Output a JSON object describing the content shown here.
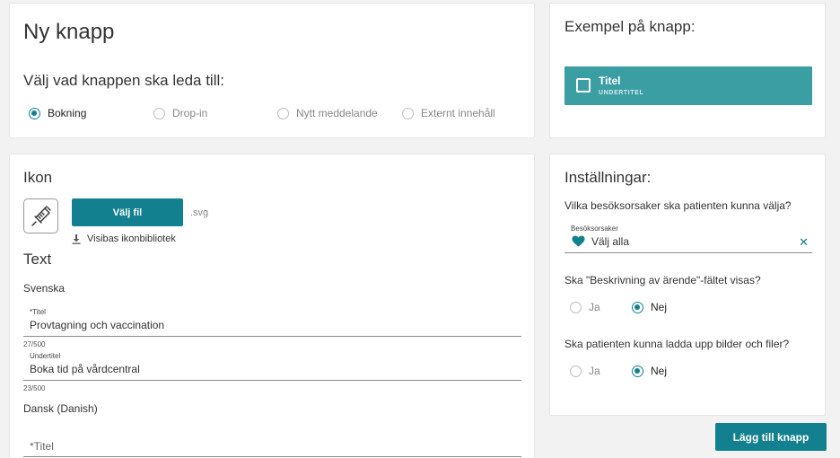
{
  "type_card": {
    "title": "Ny knapp",
    "question": "Välj vad knappen ska leda till:",
    "options": [
      {
        "label": "Bokning",
        "selected": true
      },
      {
        "label": "Drop-in",
        "selected": false
      },
      {
        "label": "Nytt meddelande",
        "selected": false
      },
      {
        "label": "Externt innehåll",
        "selected": false
      }
    ]
  },
  "preview_card": {
    "title": "Exempel på knapp:",
    "button_title": "Titel",
    "button_subtitle": "UNDERTITEL",
    "button_color": "#3a9ea3"
  },
  "icon_card": {
    "icon_heading": "Ikon",
    "icon_name": "syringe-icon",
    "choose_file_label": "Välj fil",
    "file_hint": ".svg",
    "library_link": "Visibas ikonbibliotek",
    "text_heading": "Text",
    "swedish_label": "Svenska",
    "swedish_fields": [
      {
        "label": "*Titel",
        "value": "Provtagning och vaccination",
        "counter": "27/500"
      },
      {
        "label": "Undertitel",
        "value": "Boka tid på vårdcentral",
        "counter": "23/500"
      }
    ],
    "danish_label": "Dansk (Danish)",
    "danish_fields": [
      {
        "placeholder": "*Titel"
      }
    ]
  },
  "settings_card": {
    "title": "Inställningar:",
    "cause_question": "Vilka besöksorsaker ska patienten kunna välja?",
    "cause_field_label": "Besöksorsaker",
    "cause_value": "Välj alla",
    "description_question": "Ska \"Beskrivning av ärende\"-fältet visas?",
    "description_options": [
      {
        "label": "Ja",
        "selected": false
      },
      {
        "label": "Nej",
        "selected": true
      }
    ],
    "upload_question": "Ska patienten kunna ladda upp bilder och filer?",
    "upload_options": [
      {
        "label": "Ja",
        "selected": false
      },
      {
        "label": "Nej",
        "selected": true
      }
    ]
  },
  "add_button_label": "Lägg till knapp",
  "accent_color": "#12808e"
}
